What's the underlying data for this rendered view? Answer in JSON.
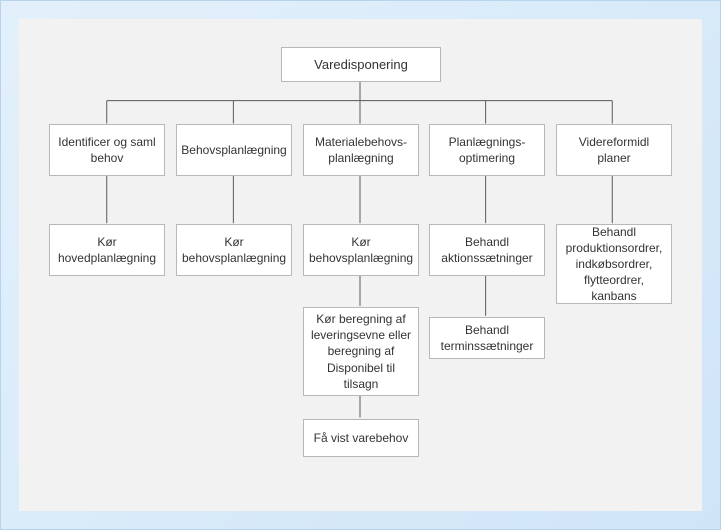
{
  "diagram": {
    "root": "Varedisponering",
    "columns": [
      {
        "heading": "Identificer og saml behov",
        "steps": [
          "Kør hovedplanlægning"
        ]
      },
      {
        "heading": "Behovsplanlægning",
        "steps": [
          "Kør behovsplanlægning"
        ]
      },
      {
        "heading": "Materialebehovs-planlægning",
        "steps": [
          "Kør behovsplanlægning",
          "Kør beregning af leveringsevne eller beregning af Disponibel til tilsagn",
          "Få vist varebehov"
        ]
      },
      {
        "heading": "Planlægnings-optimering",
        "steps": [
          "Behandl aktionssætninger",
          "Behandl terminssætninger"
        ]
      },
      {
        "heading": "Videreformidl planer",
        "steps": [
          "Behandl produktionsordrer, indkøbsordrer, flytteordrer, kanbans"
        ]
      }
    ]
  }
}
